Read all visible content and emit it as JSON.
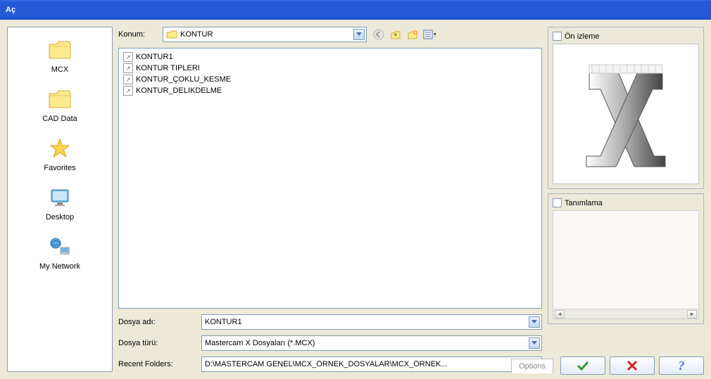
{
  "title": "Aç",
  "sidebar": {
    "items": [
      {
        "label": "MCX",
        "icon": "folder"
      },
      {
        "label": "CAD Data",
        "icon": "folder"
      },
      {
        "label": "Favorites",
        "icon": "star"
      },
      {
        "label": "Desktop",
        "icon": "desktop"
      },
      {
        "label": "My Network",
        "icon": "network"
      }
    ]
  },
  "location": {
    "label": "Konum:",
    "value": "KONTUR"
  },
  "files": {
    "items": [
      {
        "name": "KONTUR1"
      },
      {
        "name": "KONTUR TIPLERI"
      },
      {
        "name": "KONTUR_ÇOKLU_KESME"
      },
      {
        "name": "KONTUR_DELIKDELME"
      }
    ]
  },
  "fields": {
    "filename_label": "Dosya adı:",
    "filename_value": "KONTUR1",
    "filetype_label": "Dosya türü:",
    "filetype_value": "Mastercam X Dosyaları (*.MCX)",
    "recent_label": "Recent Folders:",
    "recent_value": "D:\\MASTERCAM GENEL\\MCX_ÖRNEK_DOSYALAR\\MCX_ÖRNEK..."
  },
  "right": {
    "preview_label": "Ön izleme",
    "description_label": "Tanımlama"
  },
  "bottom": {
    "options": "Options"
  }
}
